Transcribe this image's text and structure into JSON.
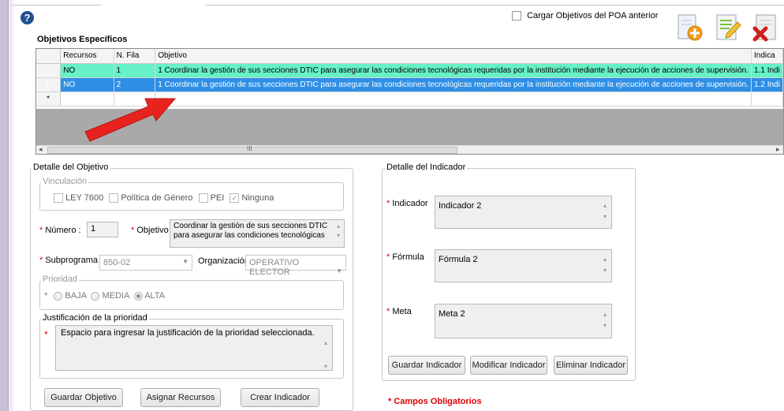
{
  "header": {
    "help_icon": "?",
    "cargar_label": "Cargar Objetivos del POA anterior",
    "section_title": "Objetivos Específicos"
  },
  "toolbar": {
    "icons": [
      "add-document-icon",
      "edit-document-icon",
      "delete-document-icon"
    ]
  },
  "grid": {
    "columns": [
      "Recursos",
      "N. Fila",
      "Objetivo",
      "Indica"
    ],
    "rows": [
      {
        "recursos": "NO",
        "fila": "1",
        "objetivo": "1 Coordinar la gestión de sus secciones DTIC para asegurar las condiciones tecnológicas requeridas por la institución mediante la ejecución de acciones de supervisión.",
        "indicador": "1.1 Indi"
      },
      {
        "recursos": "NO",
        "fila": "2",
        "objetivo": "1 Coordinar la gestión de sus secciones DTIC para asegurar las condiciones tecnológicas requeridas por la institución mediante la ejecución de acciones de supervisión.",
        "indicador": "1.2 Indi"
      }
    ],
    "new_row_marker": "*",
    "current_row_marker": "▸",
    "scroll_thumb_label": "III",
    "arrow_color": "#e8231f"
  },
  "detalle_objetivo": {
    "title": "Detalle del Objetivo",
    "vinculacion_title": "Vinculación",
    "vinculacion_options": [
      "LEY 7600",
      "Política de Género",
      "PEI",
      "Ninguna"
    ],
    "numero_label": "Número :",
    "numero_value": "1",
    "objetivo_label": "Objetivo",
    "objetivo_value": "Coordinar la gestión de sus secciones DTIC para asegurar las condiciones tecnológicas",
    "subprograma_label": "Subprograma",
    "subprograma_value": "850-02",
    "organizacion_label": "Organización",
    "organizacion_value": "OPERATIVO ELECTOR",
    "prioridad_title": "Prioridad",
    "prioridad_options": [
      "BAJA",
      "MEDIA",
      "ALTA"
    ],
    "prioridad_selected": "ALTA",
    "justificacion_title": "Justificación de la prioridad",
    "justificacion_value": "Espacio para ingresar la justificación de la prioridad seleccionada.",
    "buttons": {
      "guardar": "Guardar Objetivo",
      "asignar": "Asignar Recursos",
      "crear": "Crear Indicador"
    }
  },
  "detalle_indicador": {
    "title": "Detalle del Indicador",
    "indicador_label": "Indicador",
    "indicador_value": "Indicador 2",
    "formula_label": "Fórmula",
    "formula_value": "Fórmula 2",
    "meta_label": "Meta",
    "meta_value": "Meta 2",
    "buttons": {
      "guardar": "Guardar Indicador",
      "modificar": "Modificar Indicador",
      "eliminar": "Eliminar Indicador"
    }
  },
  "footer": {
    "required_note": "* Campos Obligatorios"
  },
  "required_marker": "*"
}
